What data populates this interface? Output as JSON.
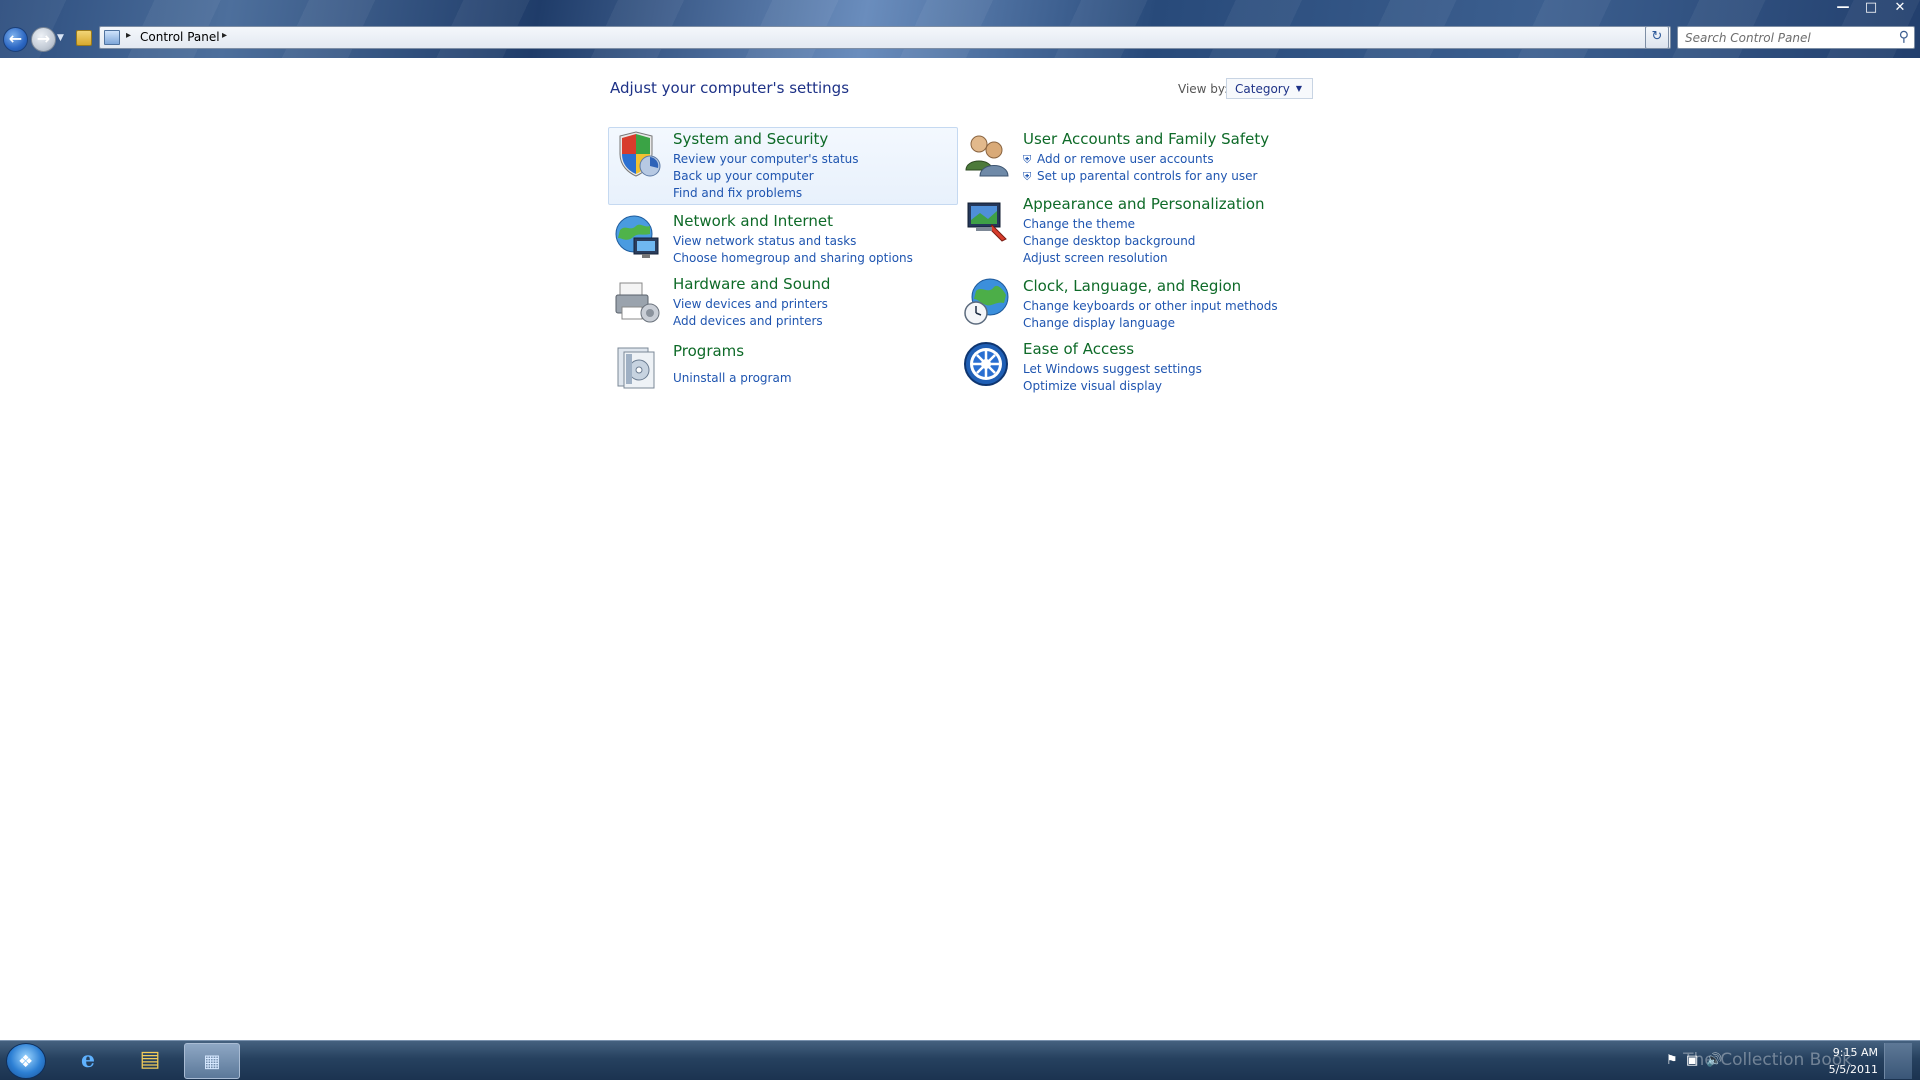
{
  "address_bar": {
    "location": "Control Panel"
  },
  "search": {
    "placeholder": "Search Control Panel"
  },
  "page": {
    "title": "Adjust your computer's settings",
    "view_by_label": "View by:",
    "view_by_value": "Category"
  },
  "categories": [
    {
      "title": "System and Security",
      "links": [
        "Review your computer's status",
        "Back up your computer",
        "Find and fix problems"
      ]
    },
    {
      "title": "Network and Internet",
      "links": [
        "View network status and tasks",
        "Choose homegroup and sharing options"
      ]
    },
    {
      "title": "Hardware and Sound",
      "links": [
        "View devices and printers",
        "Add devices and printers"
      ]
    },
    {
      "title": "Programs",
      "links": [
        "Uninstall a program"
      ]
    },
    {
      "title": "User Accounts and Family Safety",
      "links": [
        "Add or remove user accounts",
        "Set up parental controls for any user"
      ]
    },
    {
      "title": "Appearance and Personalization",
      "links": [
        "Change the theme",
        "Change desktop background",
        "Adjust screen resolution"
      ]
    },
    {
      "title": "Clock, Language, and Region",
      "links": [
        "Change keyboards or other input methods",
        "Change display language"
      ]
    },
    {
      "title": "Ease of Access",
      "links": [
        "Let Windows suggest settings",
        "Optimize visual display"
      ]
    }
  ],
  "taskbar": {
    "clock_time": "9:15 AM",
    "clock_date": "5/5/2011",
    "watermark": "The Collection Book"
  },
  "colors": {
    "category_title": "#0e6a28",
    "link": "#1f55b0",
    "page_title": "#1e3287"
  }
}
